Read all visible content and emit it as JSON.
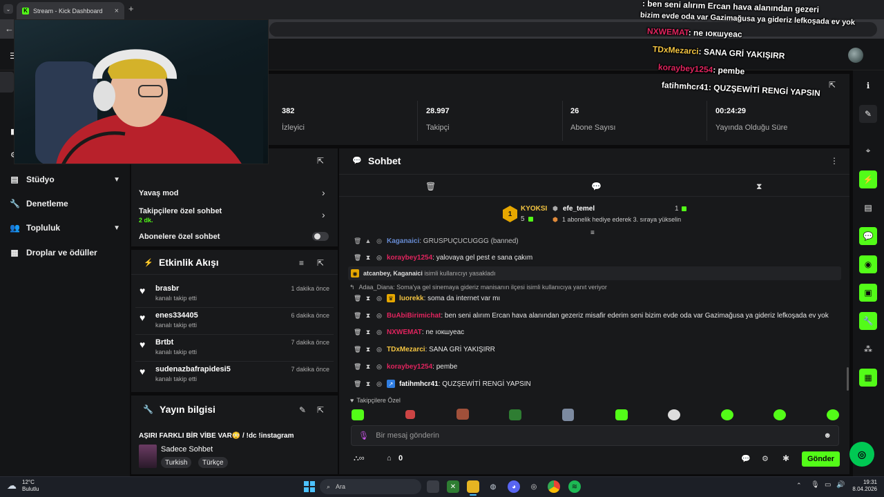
{
  "browser": {
    "tab_title": "Stream - Kick Dashboard",
    "tab_close": "×",
    "new_tab": "+",
    "tab_menu": "⌄",
    "back": "←"
  },
  "sidebar": {
    "items": [
      {
        "label": "Stüdyo",
        "icon": "studio-icon",
        "has_chevron": true
      },
      {
        "label": "Denetleme",
        "icon": "wrench-icon",
        "has_chevron": false
      },
      {
        "label": "Topluluk",
        "icon": "community-icon",
        "has_chevron": true
      },
      {
        "label": "Droplar ve ödüller",
        "icon": "drops-icon",
        "has_chevron": false
      }
    ]
  },
  "stats": [
    {
      "value": "382",
      "label": "İzleyici"
    },
    {
      "value": "28.997",
      "label": "Takipçi"
    },
    {
      "value": "26",
      "label": "Abone Sayısı"
    },
    {
      "value": "00:24:29",
      "label": "Yayında Olduğu Süre"
    }
  ],
  "chat_settings": {
    "slow_mode": "Yavaş mod",
    "followers_only": "Takipçilere özel sohbet",
    "followers_only_value": "2 dk.",
    "subs_only": "Abonelere özel sohbet"
  },
  "activity": {
    "title": "Etkinlik Akışı",
    "items": [
      {
        "name": "brasbr",
        "action": "kanalı takip etti",
        "time": "1 dakika önce"
      },
      {
        "name": "enes334405",
        "action": "kanalı takip etti",
        "time": "6 dakika önce"
      },
      {
        "name": "Brtbt",
        "action": "kanalı takip etti",
        "time": "7 dakika önce"
      },
      {
        "name": "sudenazbafrapidesi5",
        "action": "kanalı takip etti",
        "time": "7 dakika önce"
      }
    ]
  },
  "stream_info": {
    "title": "Yayın bilgisi",
    "stream_title": "AŞIRI FARKLI BİR VİBE VAR😳 / !dc !instagram",
    "category": "Sadece Sohbet",
    "tags": [
      "Turkish",
      "Türkçe"
    ]
  },
  "chat": {
    "title": "Sohbet",
    "leaderboard": {
      "first_name": "KYOKSI",
      "first_rank": "1",
      "first_count": "5",
      "second_name": "efe_temel",
      "second_count": "1",
      "second_note": "1 abonelik hediye ederek 3. sıraya yükselin"
    },
    "messages": [
      {
        "user": "Kaganaici",
        "color": "#7aa7ff",
        "text": ": GRUSPUÇUCUGGG (banned)"
      },
      {
        "user": "koraybey1254",
        "color": "#e0245e",
        "text": ": yalovaya gel pest e sana çakım"
      },
      {
        "user": "luorekk",
        "color": "#f4c542",
        "text": ": soma da internet var mı"
      },
      {
        "user": "BuAbiBirimichat",
        "color": "#e0245e",
        "text": ": ben seni alırım Ercan hava alanından gezeriz misafir ederim seni bizim evde oda var Gazimağusa ya gideriz lefkoşada ev yok"
      },
      {
        "user": "NXWEMAT",
        "color": "#e0245e",
        "text": ": ne ıокшуеас"
      },
      {
        "user": "TDxMezarci",
        "color": "#f4c542",
        "text": ": SANA GRİ YAKIŞIRR"
      },
      {
        "user": "koraybey1254",
        "color": "#e0245e",
        "text": ": pembe"
      },
      {
        "user": "fatihmhcr41",
        "color": "#ffffff",
        "text": ": QUZŞEWİTİ RENGİ YAPSIN"
      }
    ],
    "ban_notice_user": "atcanbey",
    "ban_notice_target": "Kaganaici",
    "ban_notice_text": "isimli kullanıcıyı yasakladı",
    "reply_notice": "Adaa_Diana: Soma'ya gel sinemaya gideriz manisanın ilçesi isimli kullanıcıya yanıt veriyor",
    "followers_label": "Takipçilere Özel",
    "input_placeholder": "Bir mesaj gönderin",
    "points": "0",
    "send_label": "Gönder"
  },
  "overlay": [
    {
      "user": "",
      "text": ": ben seni alırım Ercan hava alanından gezeri"
    },
    {
      "user": "",
      "text": "bizim evde oda var Gazimağusa ya gideriz lefkoşada ev yok"
    },
    {
      "user": "NXWEMAT",
      "text": ": ne ıокшуеас"
    },
    {
      "user": "TDxMezarci",
      "text": ": SANA GRİ YAKIŞIRR"
    },
    {
      "user": "koraybey1254",
      "text": ": pembe"
    },
    {
      "user": "fatihmhcr41",
      "text": ": QUZŞEWİTİ RENGİ YAPSIN"
    }
  ],
  "taskbar": {
    "weather_temp": "12°C",
    "weather_desc": "Bulutlu",
    "search": "Ara",
    "time": "19:31",
    "date": "8.04.2026"
  },
  "colors": {
    "accent": "#53fc18",
    "panel": "#18191b",
    "danger_user": "#e0245e",
    "gold_user": "#f4c542"
  }
}
